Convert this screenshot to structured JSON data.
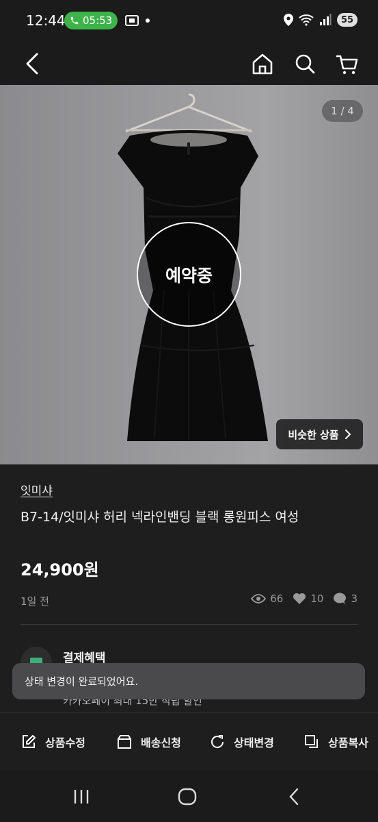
{
  "status_bar": {
    "time": "12:44",
    "call_timer": "05:53",
    "battery": "55",
    "accent_color": "#3db34a"
  },
  "top_nav": {
    "icons": [
      "back-icon",
      "home-icon",
      "search-icon",
      "cart-icon"
    ]
  },
  "image": {
    "counter": "1 / 4",
    "reserved_label": "예약중",
    "similar_button": "비슷한 상품"
  },
  "product": {
    "store": "잇미샤",
    "title": "B7-14/잇미샤 허리 넥라인밴딩 블랙 롱원피스 여성",
    "price": "24,900원",
    "time_ago": "1일 전",
    "views": "66",
    "likes": "10",
    "chats": "3"
  },
  "benefit": {
    "title": "결제혜택",
    "subtitle": "카카오페이 최대 15만 적립 할인"
  },
  "toast": {
    "message": "상태 변경이 완료되었어요."
  },
  "actions": {
    "edit": "상품수정",
    "shipping": "배송신청",
    "status": "상태변경",
    "copy": "상품복사"
  },
  "system_nav": {
    "icons": [
      "recent-apps-icon",
      "home-button-icon",
      "back-button-icon"
    ]
  }
}
